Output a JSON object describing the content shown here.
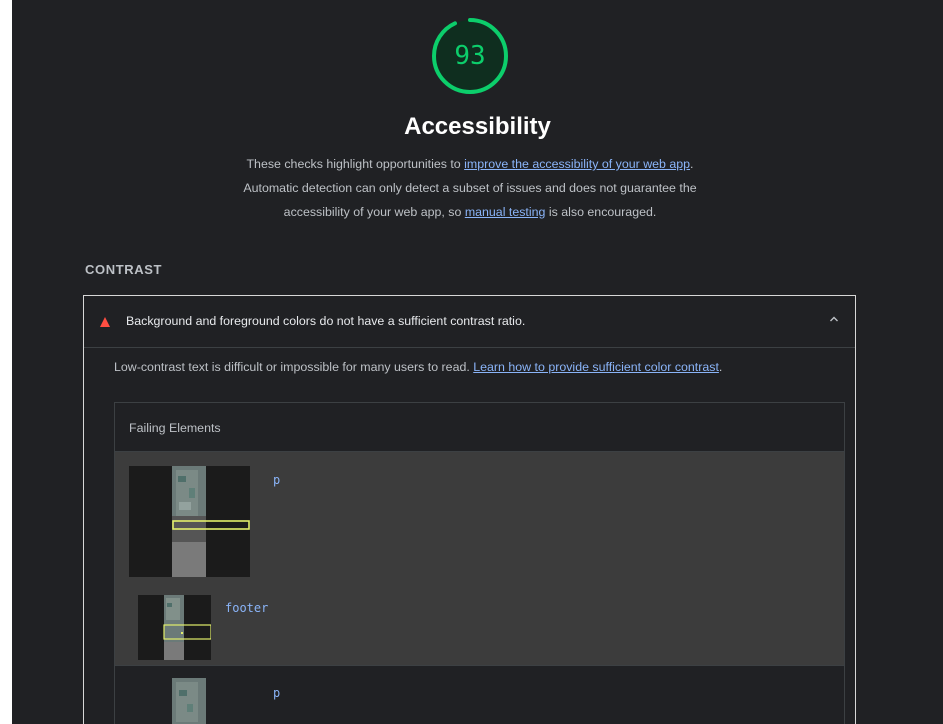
{
  "score": {
    "value": "93",
    "color": "#0cce6b",
    "fraction": 0.93
  },
  "category": {
    "title": "Accessibility",
    "desc_part1": "These checks highlight opportunities to ",
    "desc_link1": "improve the accessibility of your web app",
    "desc_part2": ". Automatic detection can only detect a subset of issues and does not guarantee the accessibility of your web app, so ",
    "desc_link2": "manual testing",
    "desc_part3": " is also encouraged."
  },
  "group": {
    "title": "CONTRAST"
  },
  "audit": {
    "title": "Background and foreground colors do not have a sufficient contrast ratio.",
    "status_color": "#ff4e42",
    "desc_text": "Low-contrast text is difficult or impossible for many users to read. ",
    "desc_link": "Learn how to provide sufficient color contrast",
    "desc_end": ".",
    "table": {
      "header": "Failing Elements",
      "rows": [
        {
          "node": "p"
        },
        {
          "node": "footer"
        },
        {
          "node": "p"
        }
      ]
    }
  }
}
